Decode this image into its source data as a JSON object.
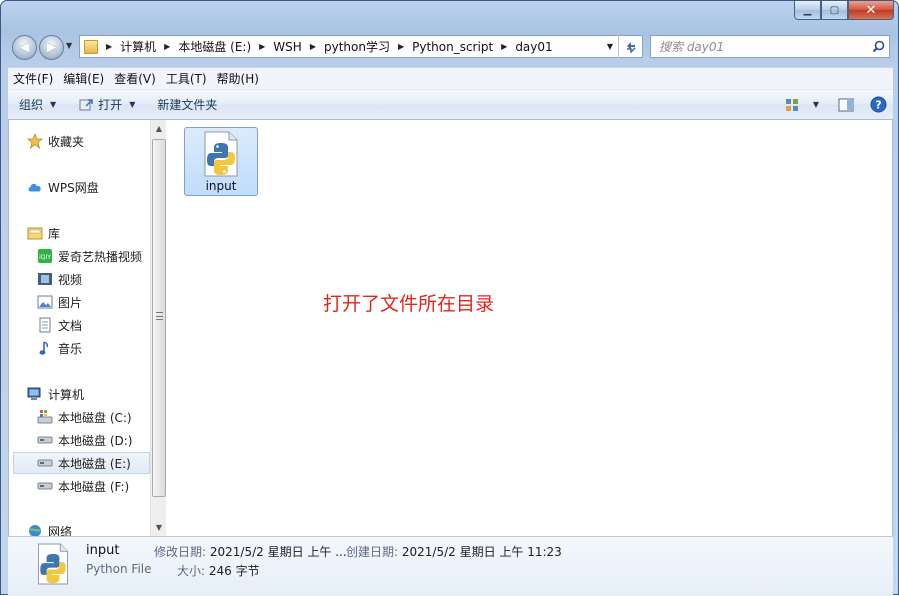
{
  "window": {
    "caption_buttons": [
      "minimize",
      "maximize",
      "close"
    ]
  },
  "address": {
    "breadcrumbs": [
      "计算机",
      "本地磁盘 (E:)",
      "WSH",
      "python学习",
      "Python_script",
      "day01"
    ]
  },
  "search": {
    "placeholder": "搜索 day01"
  },
  "menu": {
    "items": [
      "文件(F)",
      "编辑(E)",
      "查看(V)",
      "工具(T)",
      "帮助(H)"
    ]
  },
  "toolbar": {
    "organize": "组织",
    "open": "打开",
    "new_folder": "新建文件夹"
  },
  "nav": {
    "favorites": "收藏夹",
    "wps": "WPS网盘",
    "libraries": "库",
    "library_items": [
      "爱奇艺热播视频",
      "视频",
      "图片",
      "文档",
      "音乐"
    ],
    "computer": "计算机",
    "drives": [
      "本地磁盘 (C:)",
      "本地磁盘 (D:)",
      "本地磁盘 (E:)",
      "本地磁盘 (F:)"
    ],
    "network": "网络"
  },
  "files": [
    {
      "name": "input",
      "icon": "python-file-icon",
      "selected": true
    }
  ],
  "annotation": {
    "text": "打开了文件所在目录",
    "color": "#e2261d"
  },
  "details": {
    "name": "input",
    "type": "Python File",
    "modified_label": "修改日期:",
    "modified_value": "2021/5/2 星期日 上午 ...",
    "created_label": "创建日期:",
    "created_value": "2021/5/2 星期日 上午 11:23",
    "size_label": "大小:",
    "size_value": "246 字节"
  }
}
